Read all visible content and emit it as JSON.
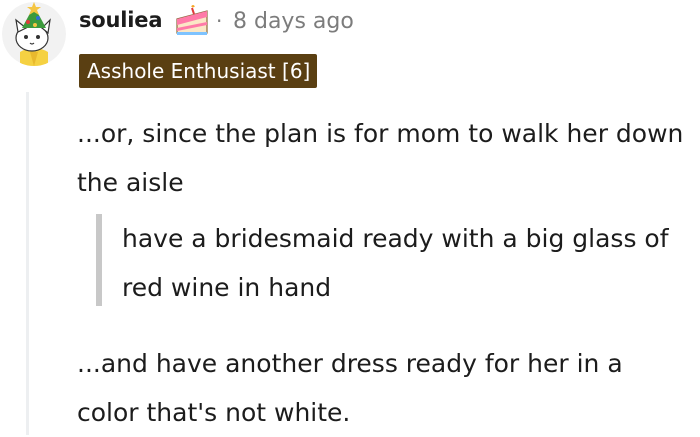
{
  "comment": {
    "avatar_icon": "snoo-avatar-icon",
    "username": "souliea",
    "cake_icon": "cake-day-icon",
    "separator": "·",
    "timestamp": "8 days ago",
    "flair": "Asshole Enthusiast [6]",
    "paragraph_1": "...or, since the plan is for mom to walk her down the aisle",
    "quote": "have a bridesmaid ready with a big glass of red wine in hand",
    "paragraph_2": "...and have another dress ready for her in a color that's not white."
  },
  "colors": {
    "flair_bg": "#5a3f12",
    "meta_gray": "#7c7c7c",
    "quote_bar": "#c8c8c8",
    "thread_line": "#edeff1"
  }
}
